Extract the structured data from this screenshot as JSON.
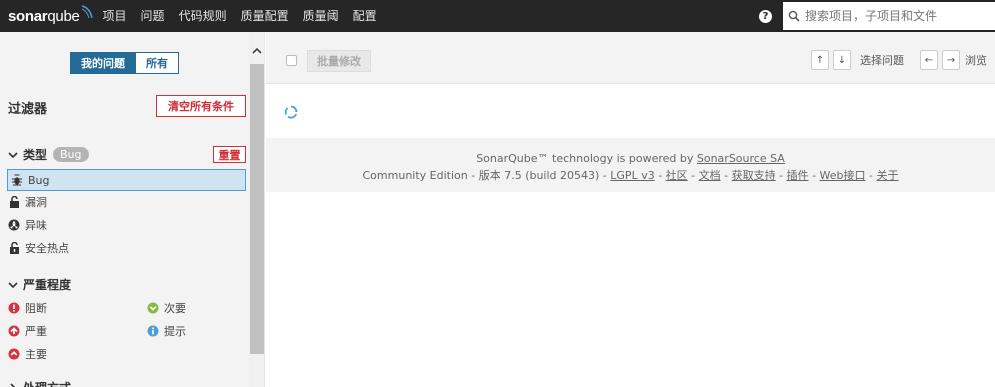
{
  "brand": {
    "name_bold": "sonar",
    "name_light": "qube"
  },
  "nav": [
    "项目",
    "问题",
    "代码规则",
    "质量配置",
    "质量阈",
    "配置"
  ],
  "search": {
    "placeholder": "搜索项目，子项目和文件"
  },
  "sidebar": {
    "toggle": {
      "mine": "我的问题",
      "all": "所有"
    },
    "filters_title": "过滤器",
    "clear_all": "清空所有条件",
    "type_facet": {
      "title": "类型",
      "badge": "Bug",
      "reset": "重置",
      "items": [
        {
          "label": "Bug",
          "icon": "bug-icon",
          "selected": true
        },
        {
          "label": "漏洞",
          "icon": "lock-icon"
        },
        {
          "label": "异味",
          "icon": "code-smell-icon"
        },
        {
          "label": "安全热点",
          "icon": "security-hotspot-icon"
        }
      ]
    },
    "severity_facet": {
      "title": "严重程度",
      "items": [
        {
          "label": "阻断",
          "icon": "blocker-icon",
          "color": "#d4333f"
        },
        {
          "label": "次要",
          "icon": "minor-icon",
          "color": "#85bb43"
        },
        {
          "label": "严重",
          "icon": "critical-icon",
          "color": "#d4333f"
        },
        {
          "label": "提示",
          "icon": "info-icon",
          "color": "#4b9fd5"
        },
        {
          "label": "主要",
          "icon": "major-icon",
          "color": "#d4333f"
        }
      ]
    },
    "resolution_facet": {
      "title": "处理方式"
    }
  },
  "toolbar": {
    "bulk_change": "批量修改",
    "up_key": "↑",
    "down_key": "↓",
    "select_issues": "选择问题",
    "left_key": "←",
    "right_key": "→",
    "navigate": "浏览"
  },
  "footer": {
    "powered_prefix": "SonarQube™ technology is powered by",
    "powered_link": "SonarSource SA",
    "edition": "Community Edition",
    "version": "版本 7.5 (build 20543)",
    "links": [
      "LGPL v3",
      "社区",
      "文档",
      "获取支持",
      "插件",
      "Web接口",
      "关于"
    ]
  }
}
